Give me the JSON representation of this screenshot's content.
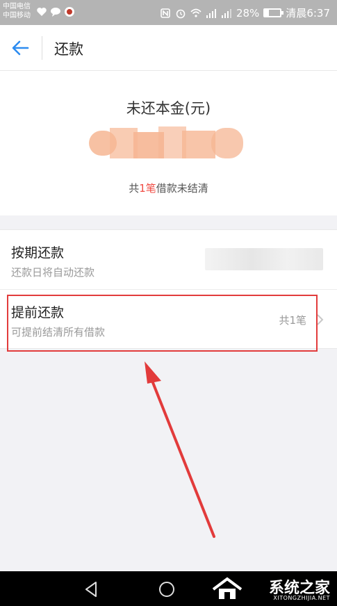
{
  "status_bar": {
    "carrier_1": "中国电信",
    "carrier_2": "中国移动",
    "battery_text": "28%",
    "battery_level": 0.28,
    "time_text": "清晨6:37"
  },
  "nav": {
    "title": "还款"
  },
  "summary": {
    "label": "未还本金(元)",
    "note_prefix": "共",
    "note_count": "1笔",
    "note_suffix": "借款未结清"
  },
  "rows": [
    {
      "title": "按期还款",
      "subtitle": "还款日将自动还款"
    },
    {
      "title": "提前还款",
      "subtitle": "可提前结清所有借款",
      "right_text": "共1笔"
    }
  ],
  "watermark": {
    "text": "系统之家",
    "sub": "XITONGZHIJIA.NET"
  },
  "colors": {
    "accent_blue": "#2d8cf0",
    "highlight_red": "#f04b43",
    "annotation_red": "#e23b3b"
  }
}
